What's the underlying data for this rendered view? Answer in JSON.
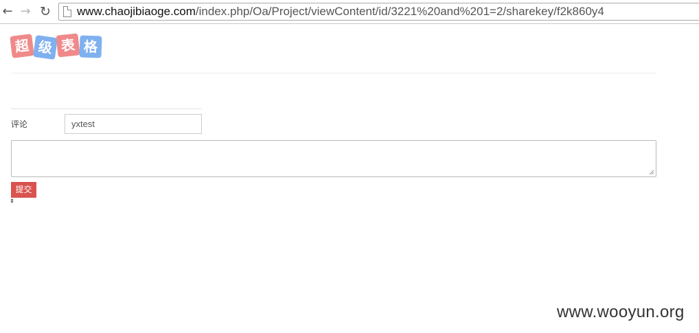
{
  "browser": {
    "back_icon": "arrow-left-icon",
    "forward_icon": "arrow-right-icon",
    "reload_icon": "reload-icon",
    "page_icon": "page-icon",
    "url_host": "www.chaojibiaoge.com",
    "url_path": "/index.php/Oa/Project/viewContent/id/3221%20and%201=2/sharekey/f2k860y4"
  },
  "logo": {
    "tiles": [
      {
        "char": "超",
        "color": "#f08a8a"
      },
      {
        "char": "级",
        "color": "#7fb0f0"
      },
      {
        "char": "表",
        "color": "#f08a8a"
      },
      {
        "char": "格",
        "color": "#7fb0f0"
      }
    ]
  },
  "form": {
    "comment_label": "评论",
    "name_value": "yxtest",
    "comment_value": "",
    "submit_label": "提交",
    "submit_color": "#d9534f"
  },
  "watermark": "www.wooyun.org"
}
